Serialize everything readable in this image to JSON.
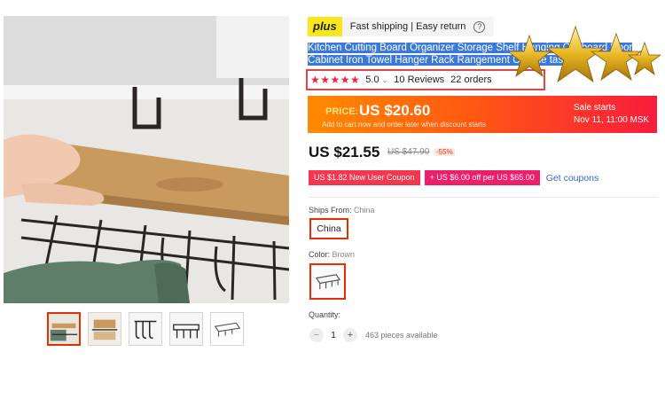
{
  "gallery": {
    "main_image_alt": "",
    "thumbnails": [
      "thumb-1",
      "thumb-2",
      "thumb-3",
      "thumb-4",
      "thumb-5"
    ],
    "active_index": 0
  },
  "shipping_bar": {
    "badge": "plus",
    "text": "Fast shipping | Easy return",
    "help": "?"
  },
  "product": {
    "title": "Kitchen Cutting Board Organizer Storage Shelf Hanging Cupboard Door Cabinet Iron Towel Hanger Rack Rangement Cuisine tassimo",
    "stars": "★★★★★",
    "rating": "5.0",
    "reviews": "10 Reviews",
    "orders": "22 orders"
  },
  "promo": {
    "label": "PRICE:",
    "price": "US $20.60",
    "note": "Add to cart now and order later when discount starts",
    "sale_title": "Sale starts",
    "sale_time": "Nov 11, 11:00 MSK"
  },
  "pricing": {
    "current": "US $21.55",
    "original": "US $47.90",
    "discount": "-55%"
  },
  "coupons": {
    "new_user": "US $1.82 New User Coupon",
    "store": "+ US $6.00 off per US $65.00",
    "get": "Get coupons"
  },
  "ships_from": {
    "label": "Ships From:",
    "value": "China",
    "option": "China"
  },
  "color": {
    "label": "Color:",
    "value": "Brown"
  },
  "quantity": {
    "label": "Quantity:",
    "minus": "−",
    "value": "1",
    "plus": "+",
    "available": "463 pieces available"
  },
  "colors": {
    "accent_red": "#e62e04",
    "title_highlight": "#3b79d8",
    "plus_yellow": "#f8e71c",
    "banner_orange": "#ff8a00",
    "banner_red": "#f81c3d",
    "link_blue": "#3366cc"
  }
}
